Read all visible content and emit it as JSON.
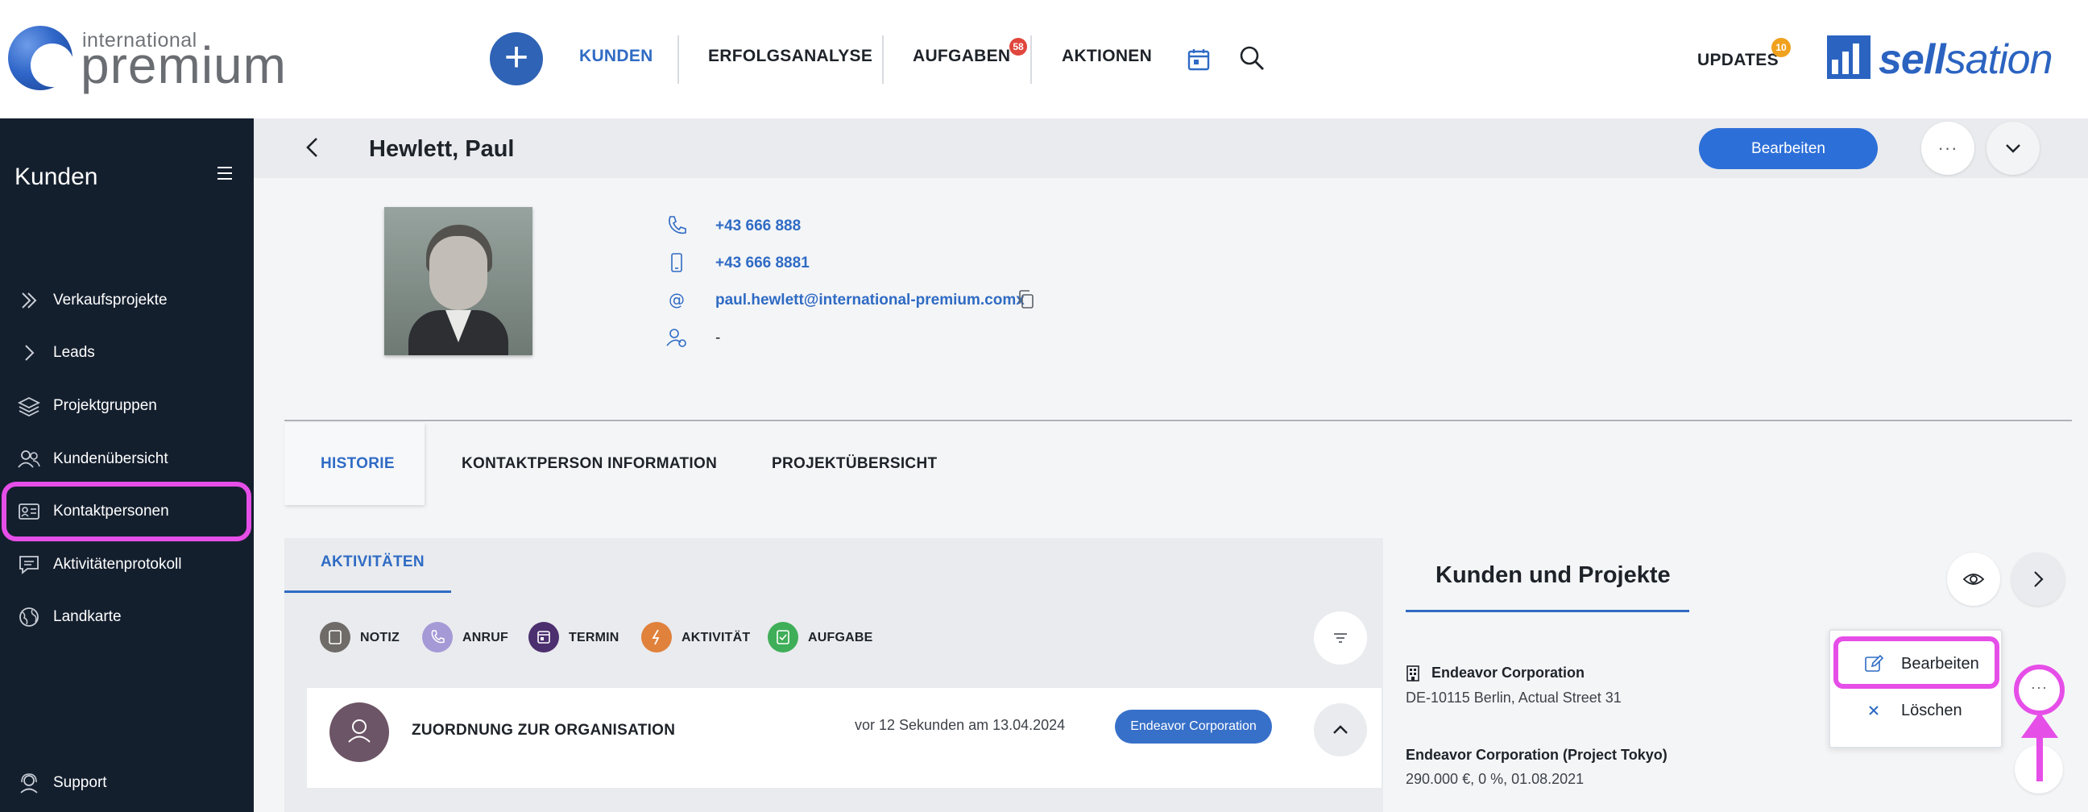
{
  "brand": {
    "left_logo_small": "international",
    "left_logo_big": "premium",
    "right_logo_bold": "sell",
    "right_logo_light": "sation"
  },
  "topnav": {
    "items": [
      {
        "label": "KUNDEN"
      },
      {
        "label": "ERFOLGSANALYSE"
      },
      {
        "label": "AUFGABEN",
        "badge": "58"
      },
      {
        "label": "AKTIONEN"
      }
    ],
    "updates_label": "UPDATES",
    "updates_badge": "10",
    "colors": {
      "accent": "#2f6bc4",
      "primary_button": "#2d6fd8",
      "badge_red": "#e0463c",
      "badge_orange": "#f0a11e"
    }
  },
  "sidebar": {
    "title": "Kunden",
    "items": [
      {
        "label": "Verkaufsprojekte",
        "icon": "double-chevron-icon"
      },
      {
        "label": "Leads",
        "icon": "chevron-right-icon"
      },
      {
        "label": "Projektgruppen",
        "icon": "layers-icon"
      },
      {
        "label": "Kundenübersicht",
        "icon": "users-icon"
      },
      {
        "label": "Kontaktpersonen",
        "icon": "contact-card-icon"
      },
      {
        "label": "Aktivitätenprotokoll",
        "icon": "chat-icon"
      },
      {
        "label": "Landkarte",
        "icon": "globe-icon"
      }
    ],
    "support_label": "Support",
    "highlight_color": "#e64ee8"
  },
  "header": {
    "name": "Hewlett, Paul",
    "edit_label": "Bearbeiten",
    "more_label": "···"
  },
  "contact": {
    "phone": "+43 666 888",
    "mobile": "+43 666 8881",
    "email": "paul.hewlett@international-premium.comx",
    "role": "-"
  },
  "tabs": [
    {
      "label": "HISTORIE",
      "active": true
    },
    {
      "label": "KONTAKTPERSON INFORMATION",
      "active": false
    },
    {
      "label": "PROJEKTÜBERSICHT",
      "active": false
    }
  ],
  "activities": {
    "tab_label": "AKTIVITÄTEN",
    "legend": [
      {
        "label": "NOTIZ",
        "color": "#6e6b68"
      },
      {
        "label": "ANRUF",
        "color": "#a59ad6"
      },
      {
        "label": "TERMIN",
        "color": "#4c2f6f"
      },
      {
        "label": "AKTIVITÄT",
        "color": "#e0813c"
      },
      {
        "label": "AUFGABE",
        "color": "#3fae58"
      }
    ],
    "entry": {
      "title": "ZUORDNUNG ZUR ORGANISATION",
      "time": "vor 12 Sekunden am 13.04.2024",
      "org": "Endeavor Corporation"
    }
  },
  "kunden_projekte": {
    "title": "Kunden und Projekte",
    "org_name": "Endeavor Corporation",
    "org_address": "DE-10115 Berlin, Actual Street 31",
    "project_name": "Endeavor Corporation (Project Tokyo)",
    "project_details": "290.000 €, 0 %, 01.08.2021",
    "more_label": "···"
  },
  "context_menu": {
    "edit_label": "Bearbeiten",
    "delete_label": "Löschen"
  }
}
